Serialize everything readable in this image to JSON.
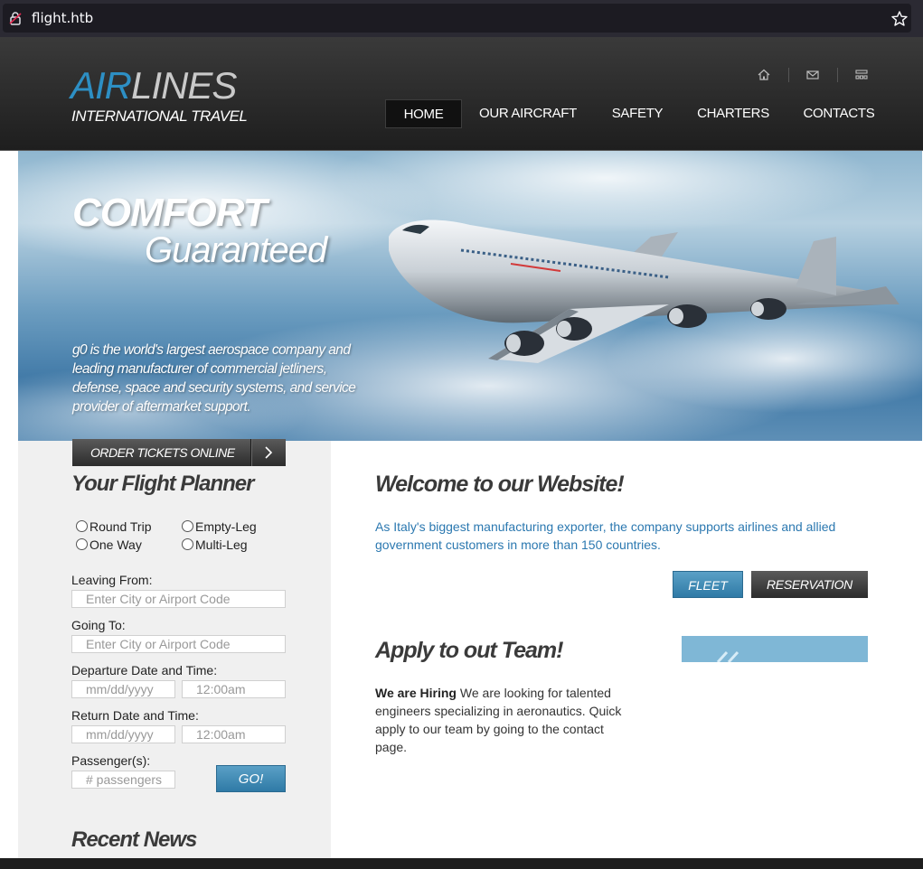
{
  "browser": {
    "url": "flight.htb"
  },
  "brand": {
    "logo_air": "AIR",
    "logo_lines": "LINES",
    "logo_sub": "INTERNATIONAL TRAVEL"
  },
  "nav": {
    "items": [
      {
        "label": "HOME",
        "active": true
      },
      {
        "label": "OUR AIRCRAFT"
      },
      {
        "label": "SAFETY"
      },
      {
        "label": "CHARTERS"
      },
      {
        "label": "CONTACTS"
      }
    ],
    "utility_icons": [
      "home-icon",
      "mail-icon",
      "sitemap-icon"
    ]
  },
  "hero": {
    "title_line1": "COMFORT",
    "title_line2": "Guaranteed",
    "description": "g0 is the world's largest aerospace company and leading manufacturer of commercial jetliners, defense, space and security systems, and service provider of aftermarket support."
  },
  "planner": {
    "order_button": "ORDER TICKETS ONLINE",
    "title": "Your Flight Planner",
    "trip_types": [
      "Round Trip",
      "Empty-Leg",
      "One Way",
      "Multi-Leg"
    ],
    "leaving_label": "Leaving From:",
    "leaving_placeholder": "Enter City or Airport Code",
    "going_label": "Going To:",
    "going_placeholder": "Enter City or Airport Code",
    "departure_label": "Departure Date and Time:",
    "return_label": "Return Date and Time:",
    "date_placeholder": "mm/dd/yyyy",
    "time_placeholder": "12:00am",
    "passengers_label": "Passenger(s):",
    "passengers_placeholder": "# passengers",
    "go_button": "GO!"
  },
  "news": {
    "title": "Recent News"
  },
  "welcome": {
    "title": "Welcome to our Website!",
    "text": "As Italy's biggest manufacturing exporter, the company supports airlines and allied government customers in more than 150 countries.",
    "fleet_button": "FLEET",
    "reservation_button": "RESERVATION"
  },
  "apply": {
    "title": "Apply to out Team!",
    "bold_lead": "We are Hiring",
    "text": " We are looking for talented engineers specializing in aeronautics. Quick apply to our team by going to the contact page."
  },
  "colors": {
    "accent_blue": "#2d8fc4",
    "link_blue": "#2b78b0",
    "header_dark": "#2a2a2a"
  }
}
